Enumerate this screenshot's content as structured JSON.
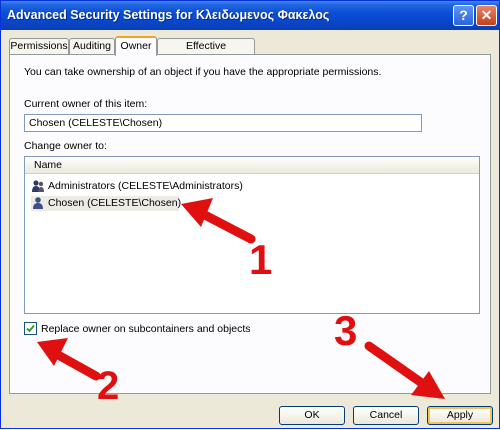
{
  "window": {
    "title": "Advanced Security Settings for Κλειδωμενος Φακελος"
  },
  "titlebar_buttons": {
    "help": "?",
    "close": "✕"
  },
  "tabs": [
    {
      "label": "Permissions"
    },
    {
      "label": "Auditing"
    },
    {
      "label": "Owner",
      "active": true
    },
    {
      "label": "Effective Permissions"
    }
  ],
  "owner_tab": {
    "info_text": "You can take ownership of an object if you have the appropriate permissions.",
    "current_owner_label": "Current owner of this item:",
    "current_owner_value": "Chosen (CELESTE\\Chosen)",
    "change_owner_label": "Change owner to:",
    "list_header": "Name",
    "owners": [
      {
        "name": "Administrators (CELESTE\\Administrators)",
        "icon": "group-users-icon",
        "selected": false
      },
      {
        "name": "Chosen (CELESTE\\Chosen)",
        "icon": "user-icon",
        "selected": true
      }
    ],
    "replace_checkbox_label": "Replace owner on subcontainers and objects",
    "replace_checked": true
  },
  "buttons": {
    "ok": "OK",
    "cancel": "Cancel",
    "apply": "Apply"
  },
  "annotations": {
    "step1": "1",
    "step2": "2",
    "step3": "3",
    "color": "#e01010"
  }
}
